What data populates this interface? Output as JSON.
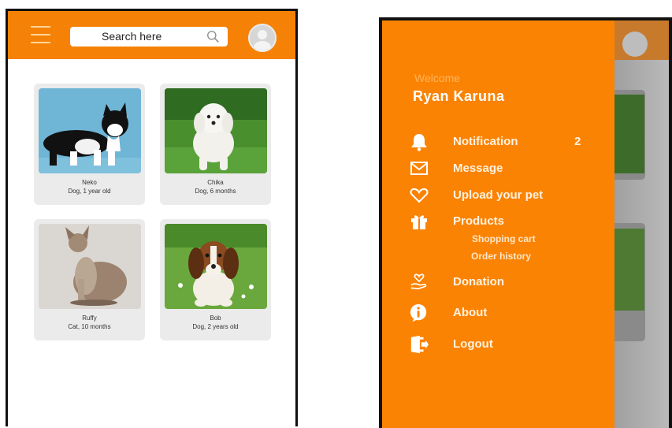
{
  "screen_home": {
    "search_placeholder": "Search here",
    "icons": {
      "menu": "hamburger-icon",
      "search": "search-icon",
      "avatar": "avatar-icon"
    },
    "pets": [
      {
        "name": "Neko",
        "description": "Dog, 1 year old"
      },
      {
        "name": "Chika",
        "description": "Dog, 6 months"
      },
      {
        "name": "Ruffy",
        "description": "Cat, 10 months"
      },
      {
        "name": "Bob",
        "description": "Dog, 2 years old"
      }
    ]
  },
  "drawer": {
    "welcome": "Welcome",
    "username": "Ryan Karuna",
    "items": [
      {
        "label": "Notification",
        "icon": "bell-icon",
        "badge": "2"
      },
      {
        "label": "Message",
        "icon": "envelope-icon"
      },
      {
        "label": "Upload your pet",
        "icon": "heart-icon"
      },
      {
        "label": "Products",
        "icon": "gift-icon"
      },
      {
        "label": "Donation",
        "icon": "donation-hand-icon"
      },
      {
        "label": "About",
        "icon": "info-icon"
      },
      {
        "label": "Logout",
        "icon": "logout-door-icon"
      }
    ],
    "products_submenu": [
      "Shopping cart",
      "Order history"
    ]
  },
  "colors": {
    "brand_orange": "#f58206",
    "drawer_orange": "#fb8304",
    "card_bg": "#ebebeb",
    "dim_overlay": "#a9a9a9"
  }
}
